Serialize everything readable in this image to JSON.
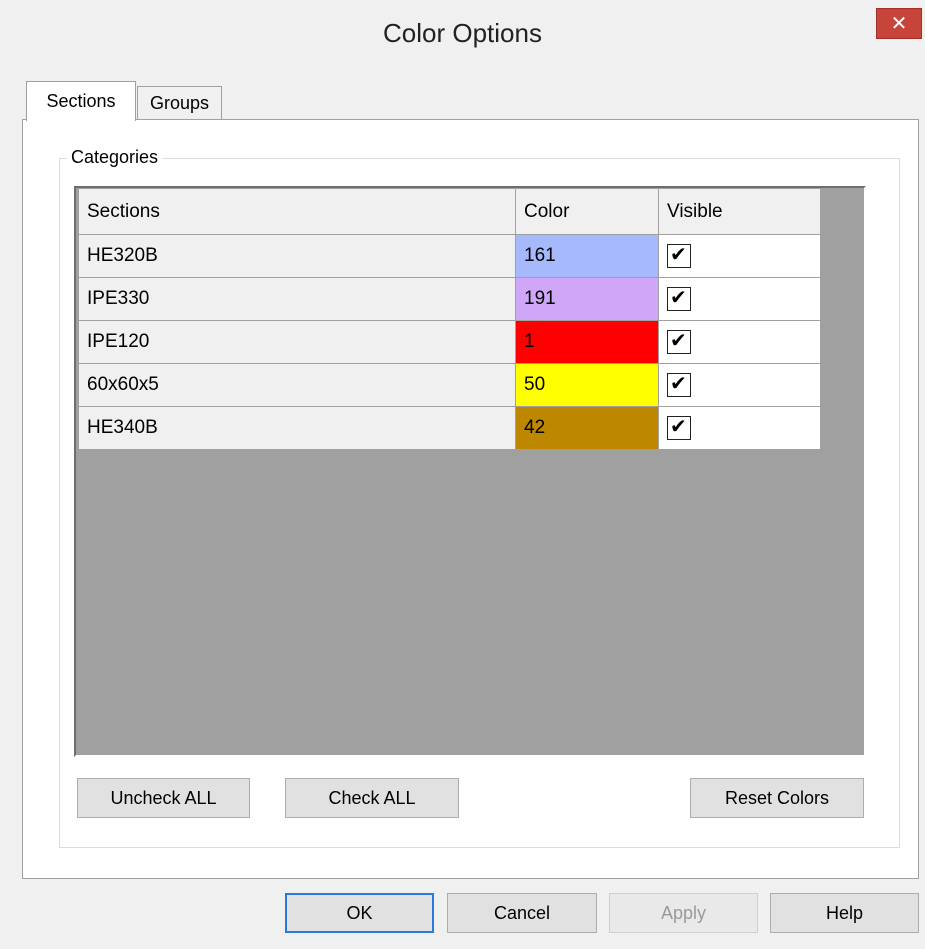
{
  "window": {
    "title": "Color Options",
    "close_glyph": "✕"
  },
  "tabs": [
    {
      "label": "Sections",
      "active": true
    },
    {
      "label": "Groups",
      "active": false
    }
  ],
  "groupbox": {
    "label": "Categories"
  },
  "grid": {
    "columns": [
      "Sections",
      "Color",
      "Visible"
    ],
    "rows": [
      {
        "section": "HE320B",
        "color_value": "161",
        "color_hex": "#a6b9fc",
        "visible": true
      },
      {
        "section": "IPE330",
        "color_value": "191",
        "color_hex": "#d0a7f8",
        "visible": true
      },
      {
        "section": "IPE120",
        "color_value": "1",
        "color_hex": "#ff0000",
        "visible": true
      },
      {
        "section": "60x60x5",
        "color_value": "50",
        "color_hex": "#ffff00",
        "visible": true
      },
      {
        "section": "HE340B",
        "color_value": "42",
        "color_hex": "#bd8700",
        "visible": true
      }
    ]
  },
  "buttons": {
    "uncheck_all": "Uncheck ALL",
    "check_all": "Check ALL",
    "reset_colors": "Reset Colors",
    "ok": "OK",
    "cancel": "Cancel",
    "apply": "Apply",
    "help": "Help"
  }
}
